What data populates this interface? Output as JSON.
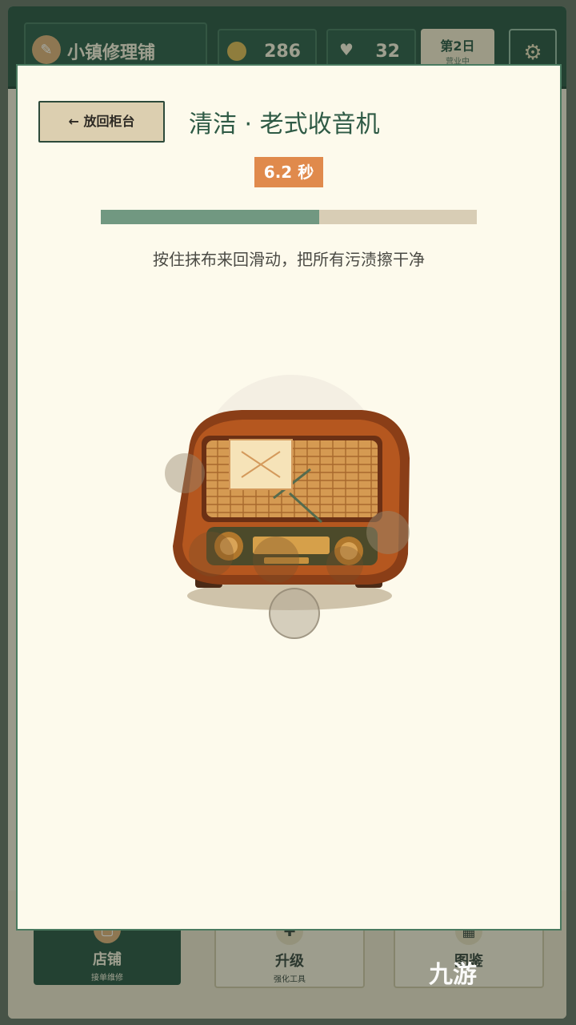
{
  "header": {
    "shop_name": "小镇修理铺",
    "coins": "286",
    "hearts": "32",
    "day": "第2日",
    "day_sub": "营业中"
  },
  "nav": {
    "shop_label": "店铺",
    "shop_sub": "接单维修",
    "upgrade_label": "升级",
    "upgrade_sub": "强化工具",
    "more_label": "图鉴"
  },
  "modal": {
    "back_label": "← 放回柜台",
    "title": "清洁 · 老式收音机",
    "timer": "6.2 秒",
    "progress": 0.58,
    "hint": "按住抹布来回滑动，把所有污渍擦干净"
  },
  "watermark": "九游",
  "colors": {
    "header_green": "#1f4a38",
    "accent_orange": "#e08a4c",
    "progress_fill": "#719881",
    "modal_bg": "#fdfaec"
  }
}
